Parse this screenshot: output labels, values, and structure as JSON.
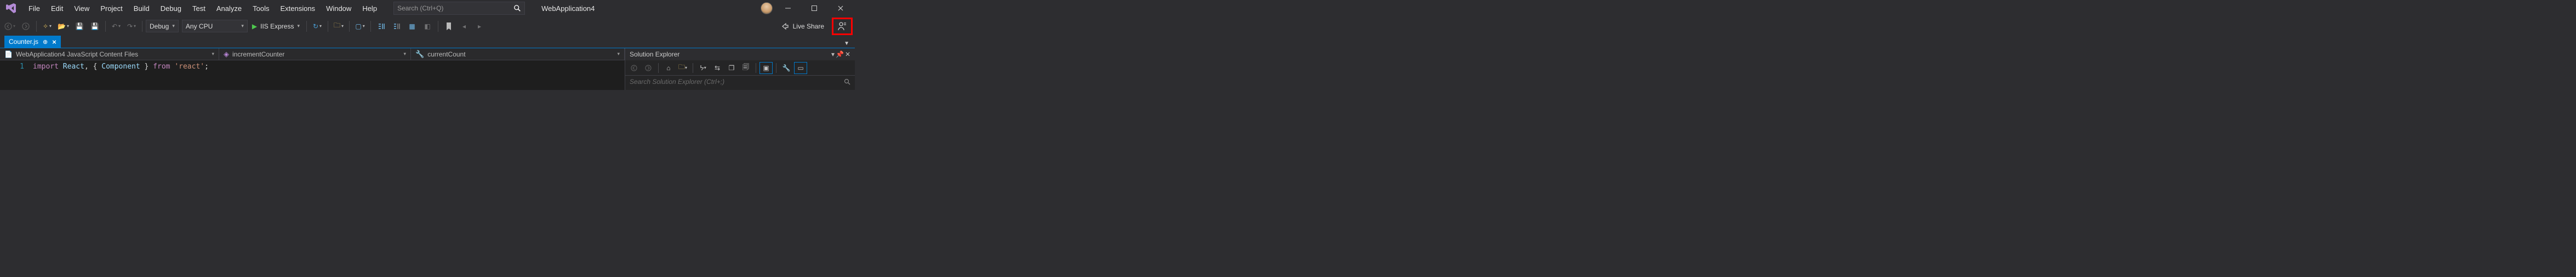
{
  "menubar": {
    "items": [
      "File",
      "Edit",
      "View",
      "Project",
      "Build",
      "Debug",
      "Test",
      "Analyze",
      "Tools",
      "Extensions",
      "Window",
      "Help"
    ],
    "search_placeholder": "Search (Ctrl+Q)",
    "app_title": "WebApplication4"
  },
  "toolbar": {
    "config_label": "Debug",
    "platform_label": "Any CPU",
    "run_label": "IIS Express",
    "liveshare_label": "Live Share"
  },
  "tab": {
    "filename": "Counter.js"
  },
  "navbar": {
    "scope": "WebApplication4 JavaScript Content Files",
    "member": "incrementCounter",
    "detail": "currentCount"
  },
  "code": {
    "line_no": "1",
    "tokens": {
      "kw_import": "import",
      "id_react": "React",
      "punct1": ", {",
      "id_component": "Component",
      "punct2": "}",
      "kw_from": "from",
      "str_react": "'react'",
      "semi": ";"
    }
  },
  "side_panel": {
    "title": "Solution Explorer",
    "search_placeholder": "Search Solution Explorer (Ctrl+;)"
  }
}
